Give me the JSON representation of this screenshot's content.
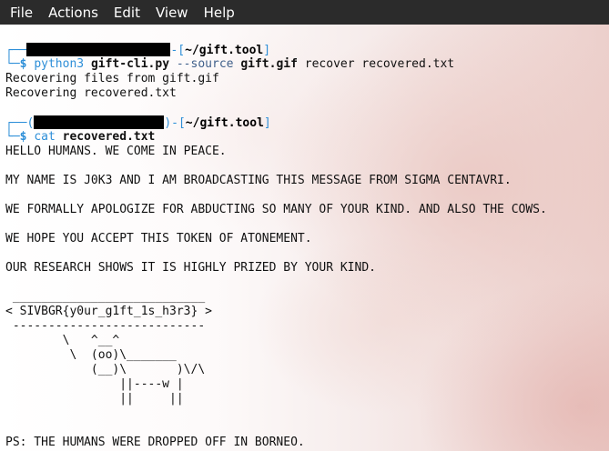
{
  "menubar": {
    "file": "File",
    "actions": "Actions",
    "edit": "Edit",
    "view": "View",
    "help": "Help"
  },
  "terminal": {
    "prompt1": {
      "head_open": "┌──",
      "head_mid": "-[",
      "path": "~/gift.tool",
      "head_close": "]",
      "tail": "└─",
      "dollar": "$",
      "command": "python3",
      "script": "gift-cli.py",
      "option": "--source",
      "source_file": "gift.gif",
      "rest": "recover recovered.txt"
    },
    "output1": [
      "Recovering files from gift.gif",
      "Recovering recovered.txt"
    ],
    "prompt2": {
      "head_open": "┌──(",
      "head_mid": ")-[",
      "path": "~/gift.tool",
      "head_close": "]",
      "tail": "└─",
      "dollar": "$",
      "command": "cat",
      "file": "recovered.txt"
    },
    "message": [
      "HELLO HUMANS. WE COME IN PEACE.",
      "MY NAME IS J0K3 AND I AM BROADCASTING THIS MESSAGE FROM SIGMA CENTAVRI.",
      "WE FORMALLY APOLOGIZE FOR ABDUCTING SO MANY OF YOUR KIND. AND ALSO THE COWS.",
      "WE HOPE YOU ACCEPT THIS TOKEN OF ATONEMENT.",
      "OUR RESEARCH SHOWS IT IS HIGHLY PRIZED BY YOUR KIND."
    ],
    "cowsay": [
      " ___________________________",
      "< SIVBGR{y0ur_g1ft_1s_h3r3} >",
      " ---------------------------",
      "        \\   ^__^",
      "         \\  (oo)\\_______",
      "            (__)\\       )\\/\\",
      "                ||----w |",
      "                ||     ||"
    ],
    "ps": "PS: THE HUMANS WERE DROPPED OFF IN BORNEO."
  },
  "colors": {
    "menubar_bg": "#2b2b2b",
    "prompt_blue": "#2e8fd8",
    "text": "#111111",
    "redaction": "#000000"
  }
}
